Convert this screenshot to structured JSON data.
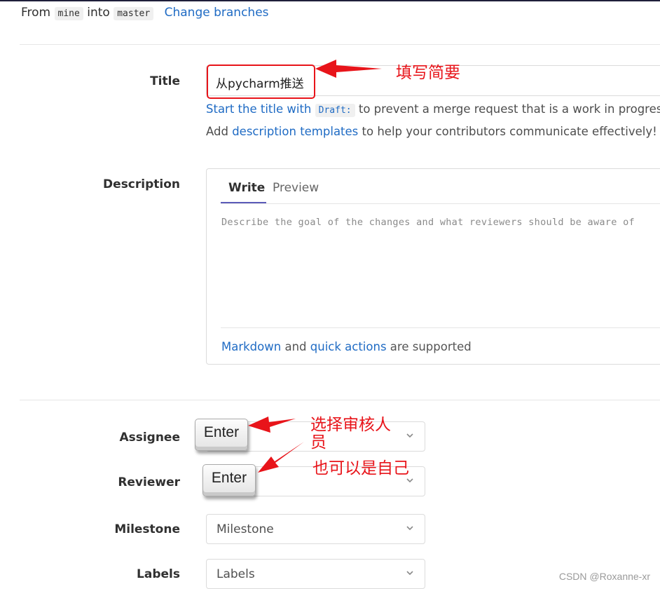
{
  "branch": {
    "from_text": "From",
    "source": "mine",
    "into_text": "into",
    "target": "master",
    "change_link": "Change branches"
  },
  "title_field": {
    "label": "Title",
    "value": "从pycharm推送",
    "hint_link": "Start the title with",
    "hint_code": "Draft:",
    "hint_rest": "to prevent a merge request that is a work in progress fro",
    "templates_prefix": "Add",
    "templates_link": "description templates",
    "templates_rest": "to help your contributors communicate effectively!"
  },
  "description": {
    "label": "Description",
    "tabs": [
      "Write",
      "Preview"
    ],
    "placeholder": "Describe the goal of the changes and what reviewers should be aware of",
    "markdown_link": "Markdown",
    "and_text": "and",
    "quick_actions_link": "quick actions",
    "supported_text": "are supported"
  },
  "fields": {
    "assignee_label": "Assignee",
    "reviewer_label": "Reviewer",
    "milestone_label": "Milestone",
    "milestone_placeholder": "Milestone",
    "labels_label": "Labels",
    "labels_placeholder": "Labels"
  },
  "annotations": {
    "title_note": "填写简要",
    "assignee_note_line1": "选择审核人",
    "assignee_note_line2": "员",
    "reviewer_note": "也可以是自己",
    "key_label": "Enter"
  },
  "watermark": "CSDN @Roxanne-xr",
  "colors": {
    "link": "#1f6bc4",
    "annotation_red": "#e8141a",
    "tab_active_underline": "#5b5bb8"
  }
}
